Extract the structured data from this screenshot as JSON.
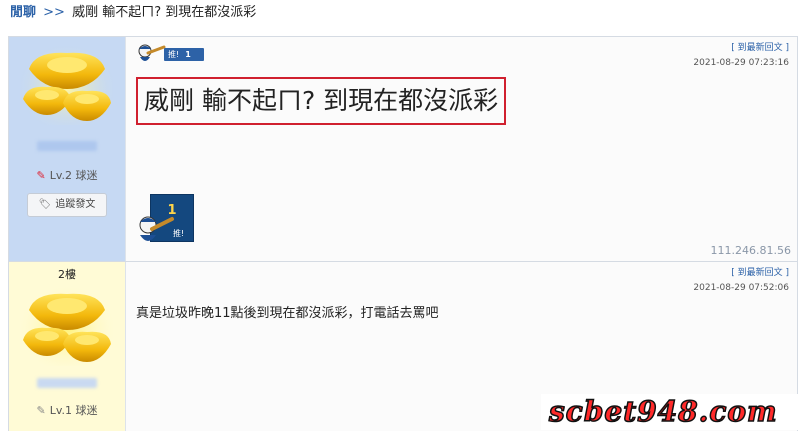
{
  "breadcrumb": {
    "board": "閒聊",
    "separator": ">>",
    "topic": "威剛 輸不起ㄇ? 到現在都沒派彩"
  },
  "posts": [
    {
      "user_level": "Lv.2",
      "user_rank": "球迷",
      "track_button": "追蹤發文",
      "jump_link": "[ 到最新回文 ]",
      "timestamp": "2021-08-29 07:23:16",
      "push_label": "推!",
      "push_count": "1",
      "content": "威剛 輸不起ㄇ? 到現在都沒派彩",
      "push_block_count": "1",
      "push_block_label": "推!",
      "ip": "111.246.81.56"
    },
    {
      "floor": "2樓",
      "user_level": "Lv.1",
      "user_rank": "球迷",
      "jump_link": "[ 到最新回文 ]",
      "timestamp": "2021-08-29 07:52:06",
      "content": "真是垃圾昨晚11點後到現在都沒派彩，打電話去罵吧"
    }
  ],
  "watermark": "scbet948.com",
  "colors": {
    "link": "#2c62a8",
    "op_sidebar": "#c6d9f3",
    "reply_sidebar": "#fffbd6",
    "highlight_border": "#d0202f",
    "push_badge": "#2d62a7",
    "watermark_text": "#ff2a2a"
  },
  "icons": {
    "avatar": "gold-ingot-icon",
    "level_op": "red-pen-icon",
    "level_reply": "grey-pen-icon",
    "track": "tag-icon",
    "push": "baseball-mascot-icon"
  }
}
